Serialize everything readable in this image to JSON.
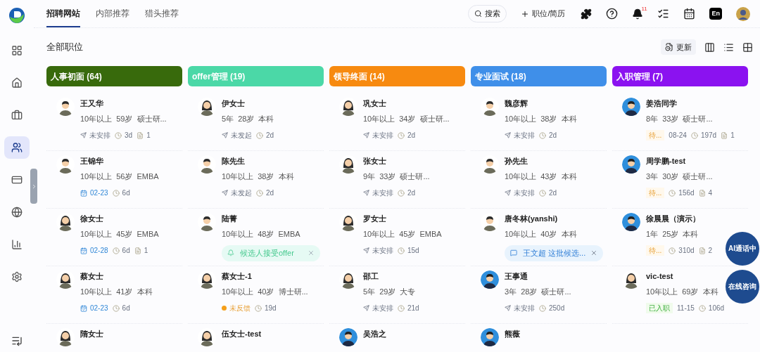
{
  "nav": {
    "tabs": [
      {
        "label": "招聘网站",
        "selected": true
      },
      {
        "label": "内部推荐",
        "selected": false
      },
      {
        "label": "猎头推荐",
        "selected": false
      }
    ],
    "search": "搜索",
    "add": "职位/简历",
    "notification_count": "11",
    "language": "En"
  },
  "sidebar": {
    "items": [
      {
        "selected": false
      },
      {
        "selected": false
      },
      {
        "selected": false
      },
      {
        "selected": true
      },
      {
        "selected": false
      },
      {
        "selected": false
      },
      {
        "selected": false
      },
      {
        "selected": false
      }
    ]
  },
  "page_title": "全部职位",
  "update_button": "更新",
  "columns": [
    {
      "title": "人事初面 (64)",
      "color": "#386a0c",
      "cards": [
        {
          "name": "王又华",
          "kind": "male",
          "info": [
            "10年以上",
            "59岁",
            "硕士研..."
          ],
          "chips": [
            {
              "kind": "status",
              "text": "未安排"
            },
            {
              "kind": "days",
              "text": "3d"
            },
            {
              "kind": "count",
              "text": "1"
            }
          ]
        },
        {
          "name": "王锦华",
          "kind": "male",
          "info": [
            "10年以上",
            "56岁",
            "EMBA"
          ],
          "chips": [
            {
              "kind": "date",
              "text": "02-23"
            },
            {
              "kind": "days",
              "text": "6d"
            }
          ]
        },
        {
          "name": "徐女士",
          "kind": "female",
          "info": [
            "10年以上",
            "45岁",
            "EMBA"
          ],
          "chips": [
            {
              "kind": "date",
              "text": "02-28"
            },
            {
              "kind": "days",
              "text": "6d"
            },
            {
              "kind": "count",
              "text": "1"
            }
          ]
        },
        {
          "name": "蔡女士",
          "kind": "female",
          "info": [
            "10年以上",
            "41岁",
            "本科"
          ],
          "chips": [
            {
              "kind": "date",
              "text": "02-23"
            },
            {
              "kind": "days",
              "text": "6d"
            }
          ]
        },
        {
          "name": "隋女士",
          "kind": "female"
        }
      ]
    },
    {
      "title": "offer管理 (19)",
      "color": "#4bd8a7",
      "cards": [
        {
          "name": "伊女士",
          "kind": "female",
          "info": [
            "5年",
            "28岁",
            "本科"
          ],
          "chips": [
            {
              "kind": "status",
              "text": "未发起"
            },
            {
              "kind": "days",
              "text": "2d"
            }
          ]
        },
        {
          "name": "陈先生",
          "kind": "male",
          "info": [
            "10年以上",
            "38岁",
            "本科"
          ],
          "chips": [
            {
              "kind": "status",
              "text": "未发起"
            },
            {
              "kind": "days",
              "text": "2d"
            }
          ]
        },
        {
          "name": "陆菁",
          "kind": "male",
          "info": [
            "10年以上",
            "48岁",
            "EMBA"
          ],
          "chips": [
            {
              "kind": "notice",
              "text": "候选人接受offer"
            }
          ]
        },
        {
          "name": "蔡女士-1",
          "kind": "female",
          "info": [
            "10年以上",
            "40岁",
            "博士研..."
          ],
          "chips": [
            {
              "kind": "feedback",
              "text": "未反馈"
            },
            {
              "kind": "days",
              "text": "19d"
            }
          ]
        },
        {
          "name": "伍女士-test",
          "kind": "female"
        }
      ]
    },
    {
      "title": "领导终面 (14)",
      "color": "#f78a10",
      "cards": [
        {
          "name": "巩女士",
          "kind": "female",
          "info": [
            "10年以上",
            "34岁",
            "硕士研..."
          ],
          "chips": [
            {
              "kind": "status",
              "text": "未安排"
            },
            {
              "kind": "days",
              "text": "2d"
            }
          ]
        },
        {
          "name": "张女士",
          "kind": "female",
          "info": [
            "9年",
            "33岁",
            "硕士研..."
          ],
          "chips": [
            {
              "kind": "status",
              "text": "未安排"
            },
            {
              "kind": "days",
              "text": "2d"
            }
          ]
        },
        {
          "name": "罗女士",
          "kind": "female",
          "info": [
            "10年以上",
            "45岁",
            "EMBA"
          ],
          "chips": [
            {
              "kind": "status",
              "text": "未安排"
            },
            {
              "kind": "days",
              "text": "15d"
            }
          ]
        },
        {
          "name": "邵工",
          "kind": "female",
          "info": [
            "5年",
            "29岁",
            "大专"
          ],
          "chips": [
            {
              "kind": "status",
              "text": "未安排"
            },
            {
              "kind": "days",
              "text": "21d"
            }
          ]
        },
        {
          "name": "吴浩之",
          "kind": "photo"
        }
      ]
    },
    {
      "title": "专业面试 (18)",
      "color": "#3f8fe9",
      "cards": [
        {
          "name": "魏彦辉",
          "kind": "male",
          "info": [
            "10年以上",
            "38岁",
            "本科"
          ],
          "chips": [
            {
              "kind": "status",
              "text": "未安排"
            },
            {
              "kind": "days",
              "text": "2d"
            }
          ]
        },
        {
          "name": "孙先生",
          "kind": "male",
          "info": [
            "10年以上",
            "43岁",
            "本科"
          ],
          "chips": [
            {
              "kind": "status",
              "text": "未安排"
            },
            {
              "kind": "days",
              "text": "2d"
            }
          ]
        },
        {
          "name": "唐冬林(yanshi)",
          "kind": "male",
          "info": [
            "10年以上",
            "40岁",
            "本科"
          ],
          "chips": [
            {
              "kind": "comment",
              "text": "王文超 这批候选..."
            }
          ]
        },
        {
          "name": "王事通",
          "kind": "photo",
          "info": [
            "3年",
            "28岁",
            "硕士研..."
          ],
          "chips": [
            {
              "kind": "status",
              "text": "未安排"
            },
            {
              "kind": "days",
              "text": "250d"
            }
          ]
        },
        {
          "name": "熊薇",
          "kind": "photo"
        }
      ]
    },
    {
      "title": "入职管理 (7)",
      "color": "#8b12f0",
      "cards": [
        {
          "name": "姜浩同学",
          "kind": "photo",
          "info": [
            "8年",
            "33岁",
            "硕士研..."
          ],
          "chips": [
            {
              "kind": "pending",
              "text": "待..."
            },
            {
              "kind": "plain",
              "text": "08-24"
            },
            {
              "kind": "days",
              "text": "197d"
            },
            {
              "kind": "count",
              "text": "1"
            }
          ]
        },
        {
          "name": "周学鹏-test",
          "kind": "photo",
          "info": [
            "3年",
            "30岁",
            "硕士研..."
          ],
          "chips": [
            {
              "kind": "pending",
              "text": "待..."
            },
            {
              "kind": "days",
              "text": "156d"
            },
            {
              "kind": "count",
              "text": "4"
            }
          ]
        },
        {
          "name": "徐晨晨（演示）",
          "kind": "photo",
          "info": [
            "1年",
            "25岁",
            "本科"
          ],
          "chips": [
            {
              "kind": "pending",
              "text": "待..."
            },
            {
              "kind": "days",
              "text": "310d"
            },
            {
              "kind": "count",
              "text": "2"
            }
          ]
        },
        {
          "name": "vic-test",
          "kind": "female",
          "info": [
            "10年以上",
            "69岁",
            "本科"
          ],
          "chips": [
            {
              "kind": "hired",
              "text": "已入职"
            },
            {
              "kind": "plain",
              "text": "11-15"
            },
            {
              "kind": "days",
              "text": "106d"
            }
          ]
        }
      ]
    }
  ],
  "float_buttons": [
    "AI通话中",
    "在线咨询"
  ]
}
